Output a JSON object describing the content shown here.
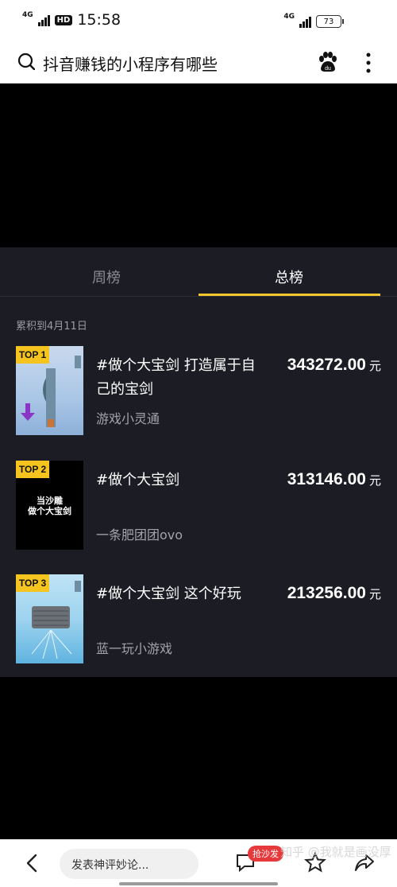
{
  "status": {
    "time": "15:58",
    "network_left": "4G",
    "network_right": "4G",
    "battery": "73",
    "hd": "HD"
  },
  "search": {
    "query": "抖音赚钱的小程序有哪些"
  },
  "ranking": {
    "tabs": [
      {
        "label": "周榜"
      },
      {
        "label": "总榜"
      }
    ],
    "active_tab": "总榜",
    "cumulative": "累积到4月11日",
    "items": [
      {
        "rank": "TOP 1",
        "title": "#做个大宝剑 打造属于自己的宝剑",
        "author": "游戏小灵通",
        "amount": "343272.00",
        "unit": "元"
      },
      {
        "rank": "TOP 2",
        "title": "#做个大宝剑",
        "author": "一条肥团团ovo",
        "amount": "313146.00",
        "unit": "元",
        "thumb_text": "当沙雕\n做个大宝剑"
      },
      {
        "rank": "TOP 3",
        "title": "#做个大宝剑 这个好玩",
        "author": "蓝一玩小游戏",
        "amount": "213256.00",
        "unit": "元"
      }
    ]
  },
  "bottom": {
    "comment_placeholder": "发表神评妙论...",
    "badge": "抢沙发",
    "watermark": "知乎 @我就是画没厚"
  },
  "colors": {
    "accent": "#f3c72b",
    "panel_bg": "#1c1c25",
    "badge_red": "#e6393b"
  }
}
